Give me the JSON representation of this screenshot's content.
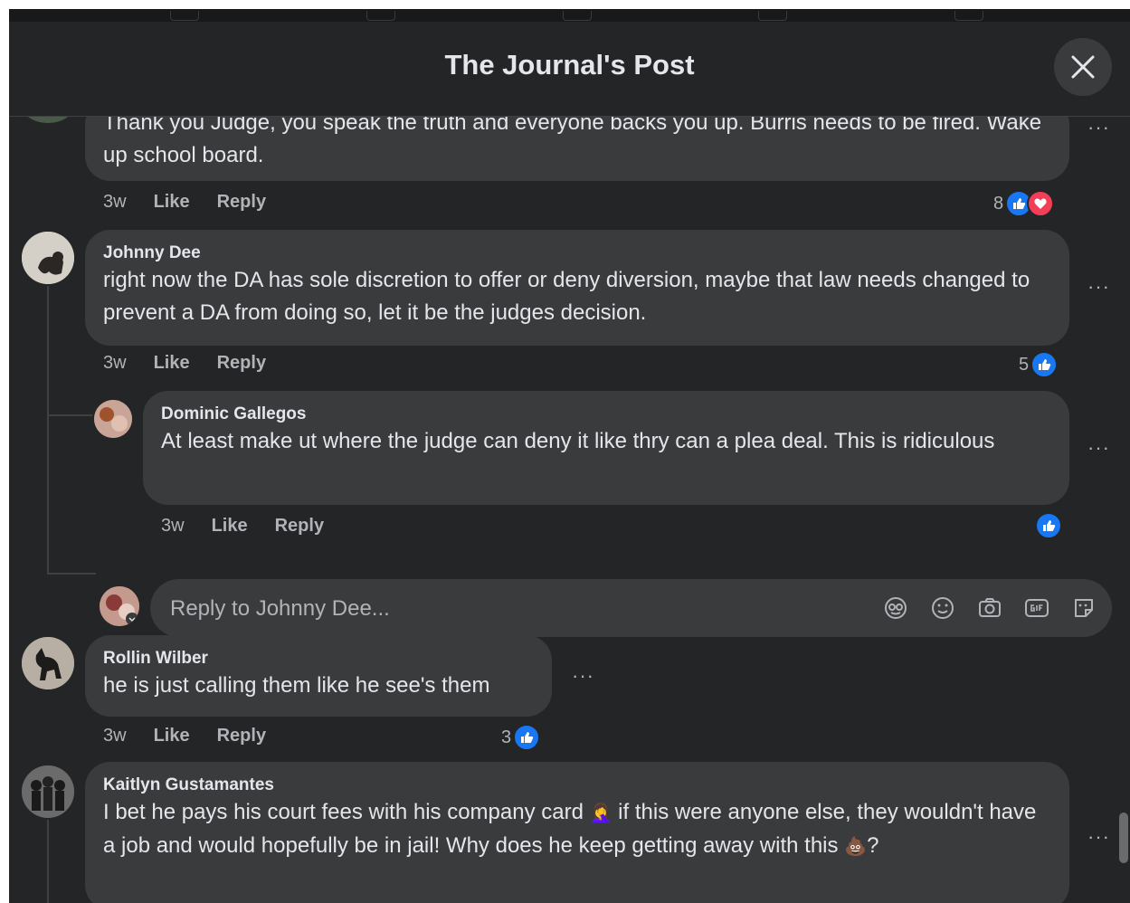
{
  "modal": {
    "title": "The Journal's Post"
  },
  "comments": [
    {
      "text": "Thank you Judge, you speak the truth and everyone backs you up. Burris needs to be fired. Wake up school board.",
      "time": "3w",
      "like_label": "Like",
      "reply_label": "Reply",
      "reaction_count": "8",
      "reactions": [
        "like-icon",
        "love-icon"
      ]
    },
    {
      "name": "Johnny Dee",
      "text": "right now the DA has sole discretion to offer or deny diversion, maybe that law needs changed to prevent a DA from doing so, let it be the judges decision.",
      "time": "3w",
      "like_label": "Like",
      "reply_label": "Reply",
      "reaction_count": "5",
      "reactions": [
        "like-icon"
      ]
    },
    {
      "name": "Dominic Gallegos",
      "text": "At least make ut where the judge can deny it like thry can a plea deal. This is ridiculous",
      "time": "3w",
      "like_label": "Like",
      "reply_label": "Reply",
      "reactions": [
        "like-icon"
      ]
    },
    {
      "name": "Rollin Wilber",
      "text": "he is just calling them like he see's them",
      "time": "3w",
      "like_label": "Like",
      "reply_label": "Reply",
      "reaction_count": "3",
      "reactions": [
        "like-icon"
      ]
    },
    {
      "name": "Kaitlyn Gustamantes",
      "text_part1": "I bet he pays his court fees with his company card ",
      "emoji1": "🤦‍♀️",
      "text_part2": " if this were anyone else, they wouldn't have a job and would hopefully be in jail! Why does he keep getting away with this ",
      "emoji2": "💩",
      "text_part3": "?"
    }
  ],
  "reply_box": {
    "placeholder": "Reply to Johnny Dee...",
    "tools": [
      "avatar-sticker-icon",
      "emoji-icon",
      "camera-icon",
      "gif-icon",
      "sticker-icon"
    ]
  },
  "more_label": "···",
  "colors": {
    "like_blue": "#1877f2",
    "love_red": "#f33e58",
    "bubble": "#3a3b3c",
    "modal_bg": "#242526"
  }
}
